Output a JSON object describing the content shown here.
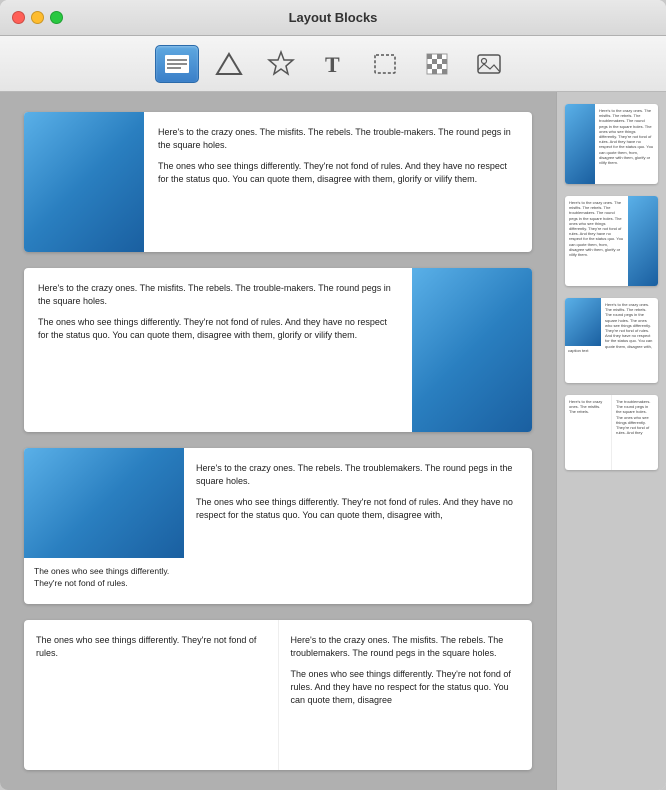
{
  "window": {
    "title": "Layout Blocks"
  },
  "toolbar": {
    "buttons": [
      {
        "id": "text-block",
        "label": "Text Block",
        "active": true
      },
      {
        "id": "triangle",
        "label": "Triangle",
        "active": false
      },
      {
        "id": "star",
        "label": "Star",
        "active": false
      },
      {
        "id": "text",
        "label": "Text",
        "active": false
      },
      {
        "id": "selection",
        "label": "Selection",
        "active": false
      },
      {
        "id": "checker",
        "label": "Checker",
        "active": false
      },
      {
        "id": "image",
        "label": "Image",
        "active": false
      }
    ]
  },
  "blocks": [
    {
      "id": "block-1",
      "layout": "image-left-text-right",
      "text1": "Here's to the crazy ones. The misfits. The rebels. The trouble-makers. The round pegs in the square holes.",
      "text2": "The ones who see things differently. They're not fond of rules. And they have no respect for the status quo. You can quote them, disagree with them, glorify or vilify them."
    },
    {
      "id": "block-2",
      "layout": "text-left-image-right",
      "text1": "Here's to the crazy ones. The misfits. The rebels. The trouble-makers. The round pegs in the square holes.",
      "text2": "The ones who see things differently. They're not fond of rules. And they have no respect for the status quo. You can quote them, disagree with them, glorify or vilify them."
    },
    {
      "id": "block-3",
      "layout": "image-topleft-text-right",
      "caption": "The ones who see things differently. They're not fond of rules.",
      "text1": "Here's to the crazy ones. The rebels. The troublemakers. The round pegs in the square holes.",
      "text2": "The ones who see things differently. They're not fond of rules. And they have no respect for the status quo. You can quote them, disagree with,"
    },
    {
      "id": "block-4",
      "layout": "two-columns",
      "text1": "The ones who see things differently. They're not fond of rules.",
      "text2": "Here's to the crazy ones. The misfits. The rebels. The troublemakers. The round pegs in the square holes.",
      "text3": "The ones who see things differently. They're not fond of rules. And they have no respect for the status quo. You can quote them, disagree"
    }
  ],
  "thumbnails": {
    "thumb1": {
      "text": "Here's to the crazy ones. The misfits. The rebels. The troublemakers. The round pegs in the square holes. The ones who see things differently. They're not fond of rules. And they have no respect for the status quo. You can quote them, from, disagree with them, glorify or vilify them."
    },
    "thumb2": {
      "text": "Here's to the crazy ones. The misfits. The rebels. The troublemakers. The round pegs in the square holes. The ones who see things differently. They're not fond of rules. And they have no respect for the status quo. You can quote them, from, disagree with them, glorify or vilify them."
    },
    "thumb3": {
      "text": "Here's to the crazy ones. The misfits. The rebels. The round pegs in the square holes. The ones who see things differently. They're not fond of rules. And they have no respect for the status quo. You can quote them, disagree with,"
    },
    "thumb4": {
      "text1": "Here's to the crazy ones. The misfits. The rebels.",
      "text2": "The troublemakers. The round pegs in the square holes. The ones who see things differently. They're not fond of rules. And they"
    }
  }
}
